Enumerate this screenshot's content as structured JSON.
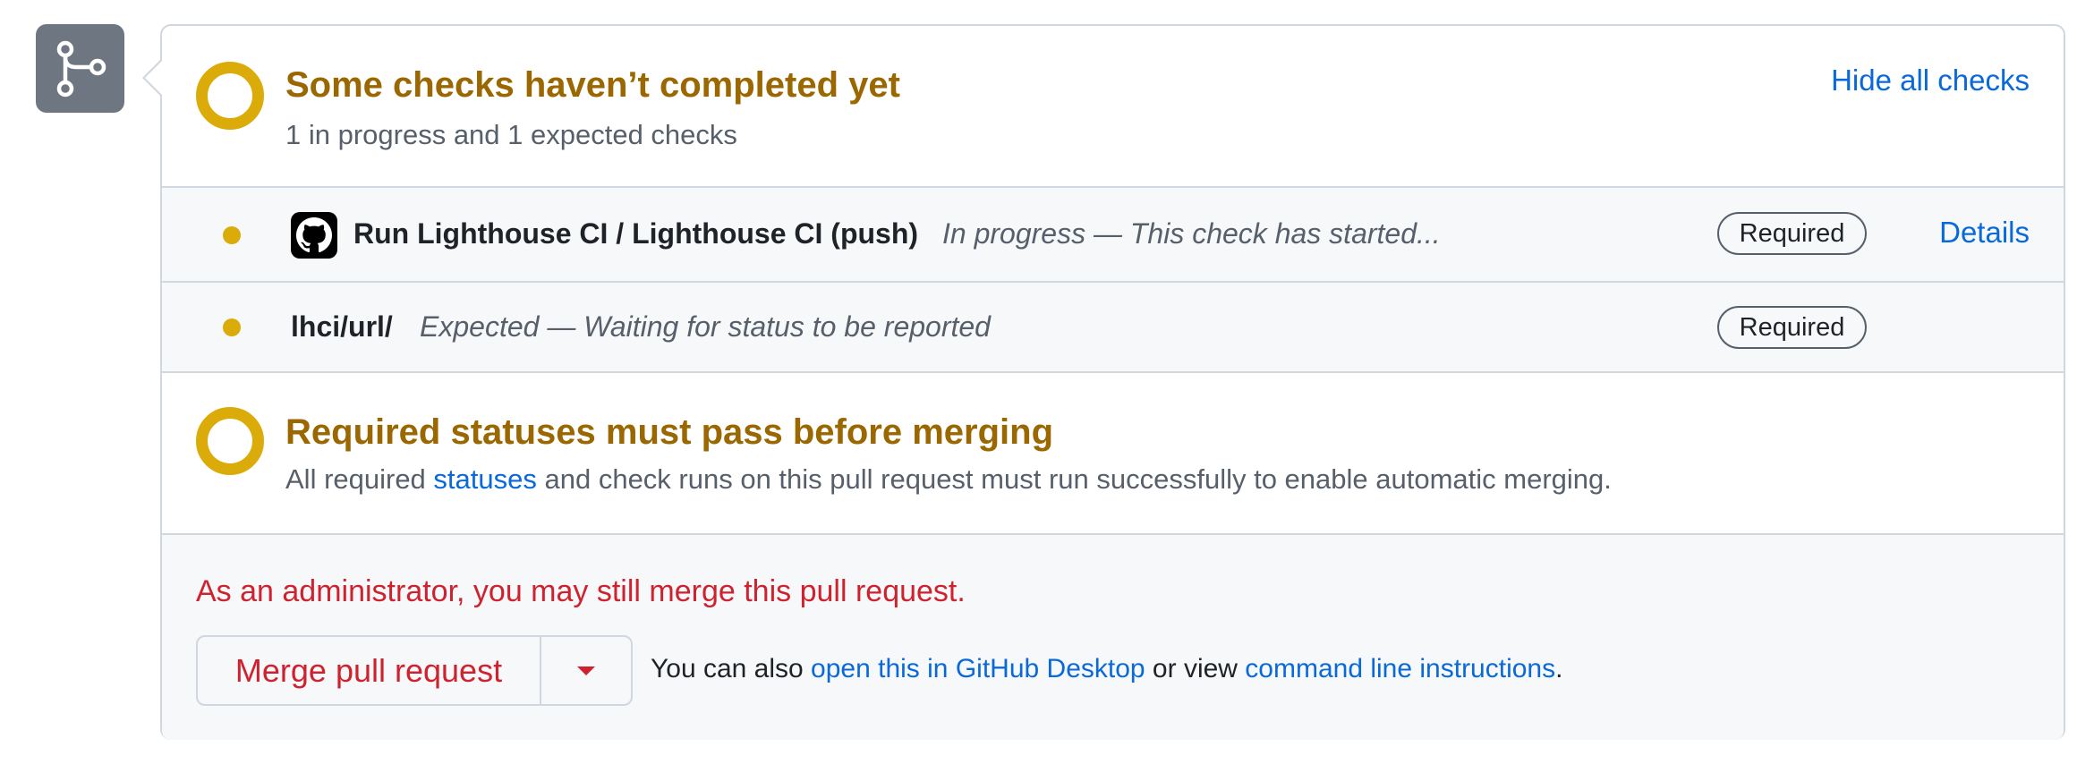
{
  "branch_badge": {
    "icon": "git-branch-icon"
  },
  "checks_header": {
    "title": "Some checks haven’t completed yet",
    "subtitle": "1 in progress and 1 expected checks",
    "toggle_label": "Hide all checks",
    "status_color": "#dbab09"
  },
  "checks": [
    {
      "name": "Run Lighthouse CI / Lighthouse CI (push)",
      "description": "In progress — This check has started...",
      "badge": "Required",
      "action": "Details",
      "app_icon": "github-octocat-icon"
    },
    {
      "name": "lhci/url/",
      "description": "Expected — Waiting for status to be reported",
      "badge": "Required"
    }
  ],
  "required_section": {
    "title": "Required statuses must pass before merging",
    "text_before": "All required ",
    "link_text": "statuses",
    "text_after": " and check runs on this pull request must run successfully to enable automatic merging."
  },
  "merge_section": {
    "admin_note": "As an administrator, you may still merge this pull request.",
    "merge_button": "Merge pull request",
    "dropdown_icon": "triangle-down-icon",
    "also_prefix": "You can also ",
    "desktop_link": "open this in GitHub Desktop",
    "also_middle": " or view ",
    "cli_link": "command line instructions",
    "also_suffix": "."
  },
  "colors": {
    "warning": "#9a6700",
    "danger": "#cf222e",
    "link": "#0969da"
  }
}
